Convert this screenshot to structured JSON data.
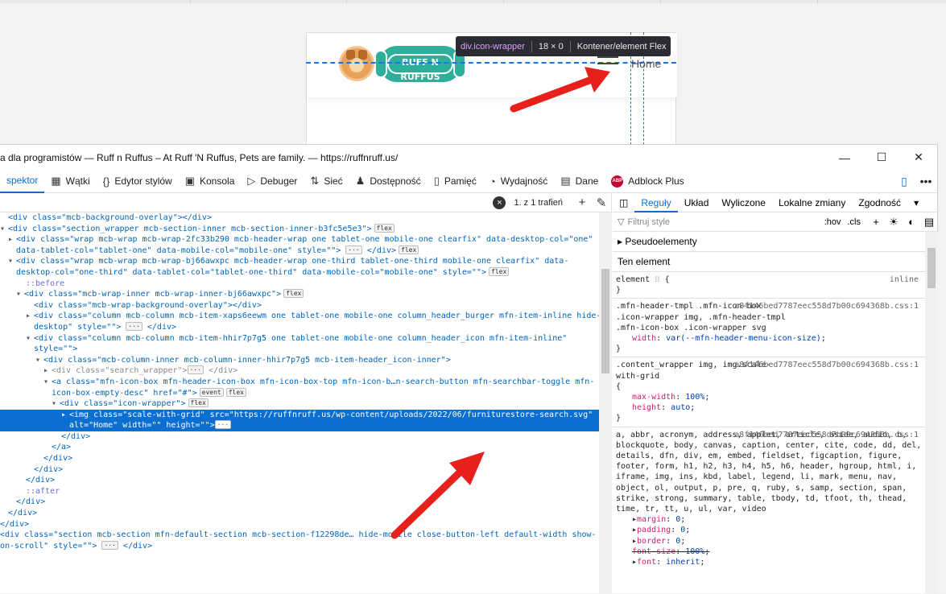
{
  "site": {
    "logo_text": "RUFF N RUFFUS",
    "alt_text": "Home",
    "tooltip": {
      "selector": "div.icon-wrapper",
      "size": "18 × 0",
      "type": "Kontener/element Flex"
    }
  },
  "window": {
    "title": "a dla programistów — Ruff n Ruffus – At Ruff 'N Ruffus, Pets are family. — https://ruffnruff.us/"
  },
  "toolbar": {
    "tabs": [
      {
        "label": "spektor",
        "icon": "inspector-icon"
      },
      {
        "label": "Wątki",
        "icon": "threads-icon"
      },
      {
        "label": "Edytor stylów",
        "icon": "braces-icon"
      },
      {
        "label": "Konsola",
        "icon": "console-icon"
      },
      {
        "label": "Debuger",
        "icon": "debugger-icon"
      },
      {
        "label": "Sieć",
        "icon": "network-icon"
      },
      {
        "label": "Dostępność",
        "icon": "accessibility-icon"
      },
      {
        "label": "Pamięć",
        "icon": "memory-icon"
      },
      {
        "label": "Wydajność",
        "icon": "performance-icon"
      },
      {
        "label": "Dane",
        "icon": "storage-icon"
      },
      {
        "label": "Adblock Plus",
        "icon": "abp-icon"
      }
    ]
  },
  "search": {
    "query": "",
    "result": "1. z 1 trafień"
  },
  "markup": {
    "lines": [
      "<div class=\"mcb-background-overlay\"></div>",
      "<div class=\"section_wrapper mcb-section-inner mcb-section-inner-b3fc5e5e3\">",
      "<div class=\"wrap mcb-wrap mcb-wrap-2fc33b290 mcb-header-wrap one tablet-one mobile-one clearfix\" data-desktop-col=\"one\"",
      "data-tablet-col=\"tablet-one\" data-mobile-col=\"mobile-one\" style=\"\">",
      "<div class=\"wrap mcb-wrap mcb-wrap-bj66awxpc mcb-header-wrap one-third tablet-one-third mobile-one clearfix\" data-",
      "desktop-col=\"one-third\" data-tablet-col=\"tablet-one-third\" data-mobile-col=\"mobile-one\" style=\"\">",
      "::before",
      "<div class=\"mcb-wrap-inner mcb-wrap-inner-bj66awxpc\">",
      "<div class=\"mcb-wrap-background-overlay\"></div>",
      "<div class=\"column mcb-column mcb-item-xaps6eewm one tablet-one mobile-one column_header_burger mfn-item-inline hide-",
      "desktop\" style=\"\">",
      "<div class=\"column mcb-column mcb-item-hhir7p7g5 one tablet-one mobile-one column_header_icon mfn-item-inline\"",
      "style=\"\">",
      "<div class=\"mcb-column-inner mcb-column-inner-hhir7p7g5 mcb-item-header_icon-inner\">",
      "<div class=\"search_wrapper\">",
      "<a class=\"mfn-icon-box mfn-header-icon-box mfn-icon-box-top mfn-icon-b…n-search-button mfn-searchbar-toggle mfn-",
      "icon-box-empty-desc\" href=\"#\">",
      "<div class=\"icon-wrapper\">",
      "<img class=\"scale-with-grid\" src=\"https://ruffnruff.us/wp-content/uploads/2022/06/furniturestore-search.svg\"",
      "alt=\"Home\" width=\"\" height=\"\">",
      "</div>",
      "</a>",
      "</div>",
      "</div>",
      "</div>",
      "::after",
      "</div>",
      "</div>",
      "</div>",
      "<div class=\"section mcb-section mfn-default-section mcb-section-f12298de… hide-mobile close-button-left default-width show-",
      "on-scroll\" style=\"\">"
    ]
  },
  "rules_panel": {
    "tabs": [
      "Reguły",
      "Układ",
      "Wyliczone",
      "Lokalne zmiany",
      "Zgodność"
    ],
    "filter_placeholder": "Filtruj style",
    "hov": ":hov",
    "cls": ".cls",
    "pseudo_label": "Pseudoelementy",
    "this_element": "Ten element",
    "element_rule": {
      "selector": "element",
      "origin": "inline"
    },
    "rule1": {
      "selector": ".mfn-header-tmpl .mfn-icon-box .icon-wrapper img, .mfn-header-tmpl .mfn-icon-box .icon-wrapper svg",
      "source": "a8f146bed7787eec558d7b00c694368b.css:1",
      "props": [
        {
          "name": "width",
          "value": "var(--mfn-header-menu-icon-size)"
        }
      ]
    },
    "rule2": {
      "selector": ".content_wrapper img, img.scale-with-grid",
      "source": "a8f146bed7787eec558d7b00c694368b.css:1",
      "props": [
        {
          "name": "max-width",
          "value": "100%"
        },
        {
          "name": "height",
          "value": "auto"
        }
      ]
    },
    "rule3": {
      "selector": "a, abbr, acronym, address, applet, article, aside, audio, b, blockquote, body, canvas, caption, center, cite, code, dd, del, details, dfn, div, em, embed, fieldset, figcaption, figure, footer, form, h1, h2, h3, h4, h5, h6, header, hgroup, html, i, iframe, img, ins, kbd, label, legend, li, mark, menu, nav, object, ol, output, p, pre, q, ruby, s, samp, section, span, strike, strong, summary, table, tbody, td, tfoot, th, thead, time, tr, tt, u, ul, var, video",
      "source": "a8f146bed7787eec558d7b00c694368b.css:1",
      "props": [
        {
          "name": "margin",
          "value": "0"
        },
        {
          "name": "padding",
          "value": "0"
        },
        {
          "name": "border",
          "value": "0"
        },
        {
          "name": "font-size",
          "value": "100%"
        },
        {
          "name": "font",
          "value": "inherit"
        }
      ]
    }
  },
  "colors": {
    "accent": "#0a6fd1",
    "selection": "#0a6fd1",
    "arrow": "#e8201c"
  }
}
